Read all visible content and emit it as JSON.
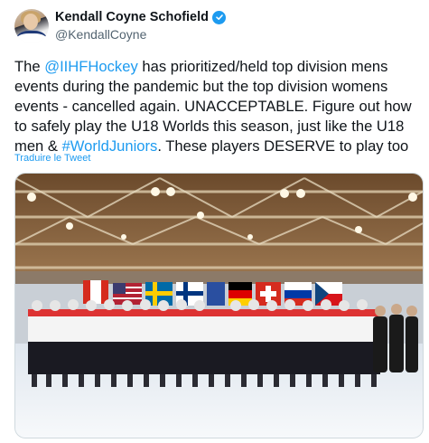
{
  "author": {
    "name": "Kendall Coyne Schofield",
    "handle": "@KendallCoyne",
    "verified_icon": "verified-badge-icon"
  },
  "tweet": {
    "lines": [
      [
        {
          "t": "The ",
          "link": false
        },
        {
          "t": "@IIHFHockey",
          "link": true
        },
        {
          "t": " has prioritized/held top division mens",
          "link": false
        }
      ],
      [
        {
          "t": "events during the pandemic but the top division womens",
          "link": false
        }
      ],
      [
        {
          "t": "events - cancelled again. UNACCEPTABLE. Figure out how",
          "link": false
        }
      ],
      [
        {
          "t": "to safely play the U18 Worlds this season, just like the U18",
          "link": false
        }
      ],
      [
        {
          "t": "men & ",
          "link": false
        },
        {
          "t": "#WorldJuniors",
          "link": true
        },
        {
          "t": ". These players DESERVE to play too",
          "link": false
        }
      ]
    ],
    "translate_label": "Traduire le Tweet"
  },
  "colors": {
    "accent": "#1d9bf0",
    "text": "#0f1419",
    "secondary": "#536471"
  }
}
